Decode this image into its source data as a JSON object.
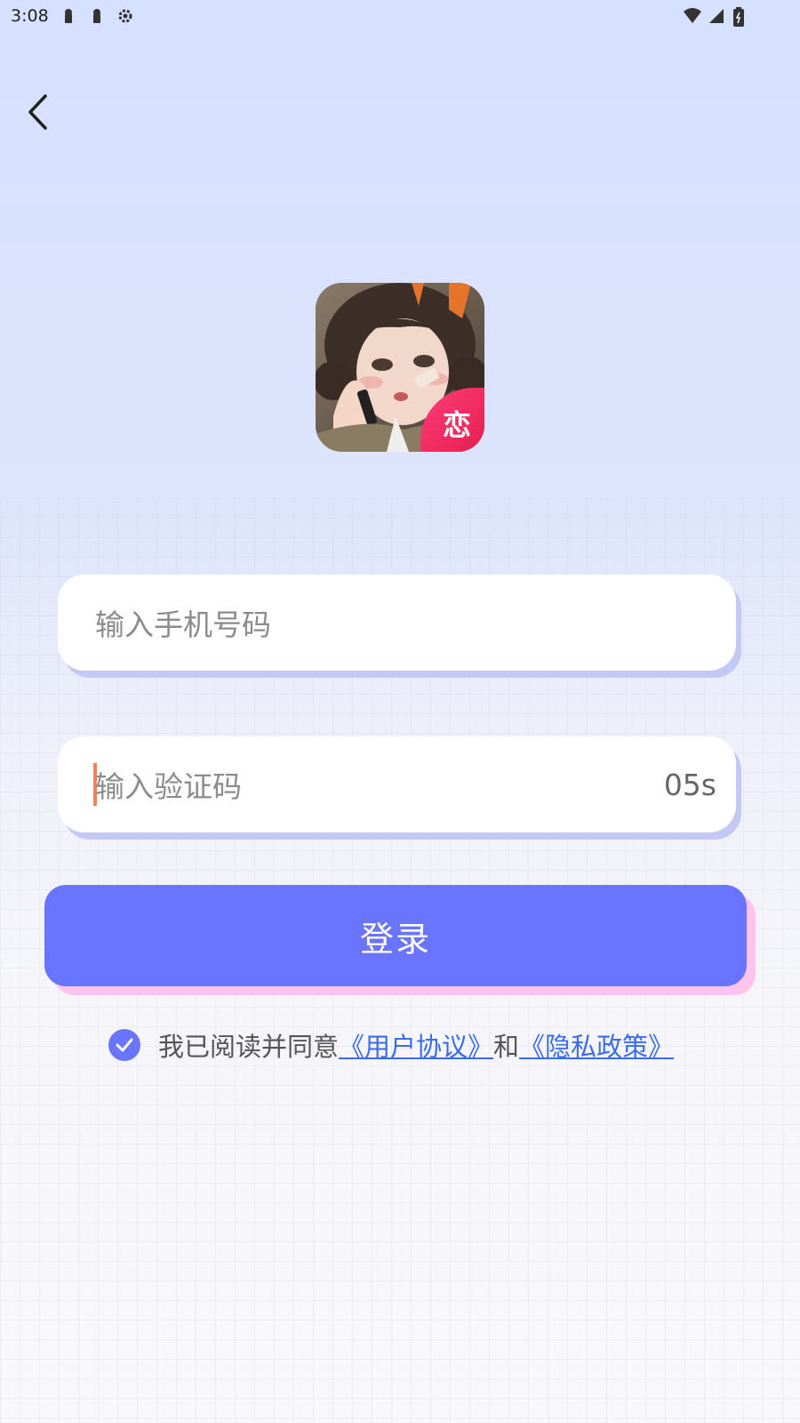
{
  "status_bar": {
    "time": "3:08",
    "left_icons": [
      "notification-icon",
      "notification-icon",
      "settings-icon"
    ],
    "right_icons": [
      "wifi-icon",
      "signal-icon",
      "battery-icon"
    ]
  },
  "header": {
    "back_icon": "chevron-left-icon"
  },
  "logo": {
    "badge_text": "恋"
  },
  "form": {
    "phone_placeholder": "输入手机号码",
    "code_placeholder": "输入验证码",
    "countdown": "05s",
    "login_label": "登录"
  },
  "agreement": {
    "checked": true,
    "prefix": "我已阅读并同意",
    "user_agreement": "《用户协议》",
    "joiner": "和",
    "privacy_policy": "《隐私政策》"
  },
  "colors": {
    "accent": "#6a75ff",
    "link": "#3a6cf0",
    "badge": "#e5204f"
  }
}
